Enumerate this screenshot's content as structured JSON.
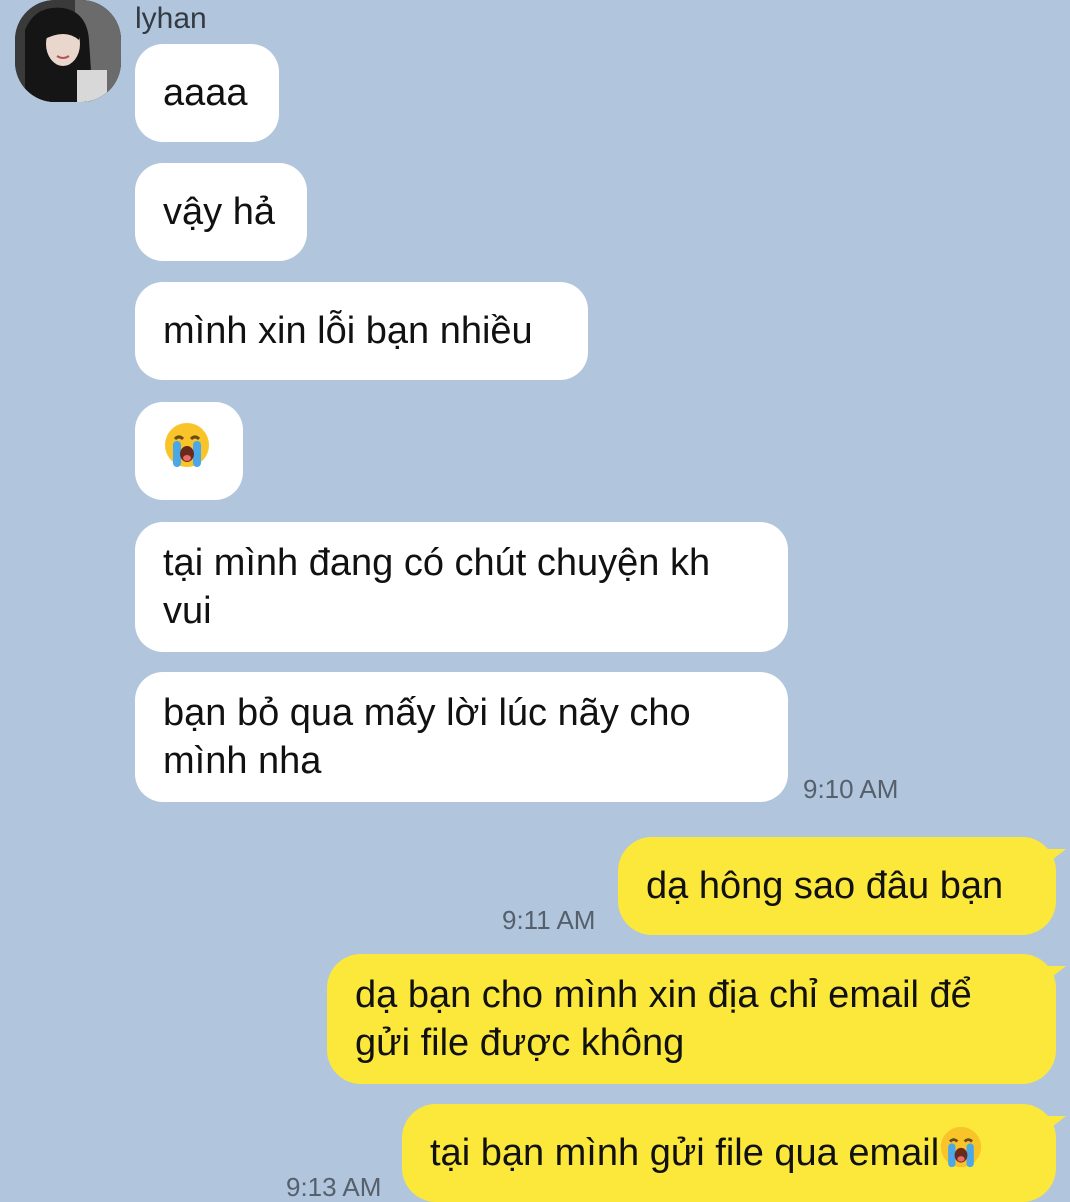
{
  "sender": {
    "name": "lyhan"
  },
  "incoming": [
    {
      "text": "aaaa"
    },
    {
      "text": "vậy hả"
    },
    {
      "text": "mình xin lỗi bạn nhiều"
    },
    {
      "text": "",
      "emoji": "loudly-crying-face-icon"
    },
    {
      "text": "tại mình đang có chút chuyện kh vui"
    },
    {
      "text": "bạn bỏ qua mấy lời lúc nãy cho mình nha",
      "time": "9:10 AM"
    }
  ],
  "outgoing": [
    {
      "text": "dạ hông sao đâu bạn",
      "time": "9:11 AM"
    },
    {
      "text": "dạ bạn cho mình xin địa chỉ email để gửi file được không"
    },
    {
      "text": "tại bạn mình gửi file qua email",
      "emoji": "loudly-crying-face-icon",
      "time": "9:13 AM"
    }
  ],
  "colors": {
    "background": "#b1c6dc",
    "incoming_bubble": "#ffffff",
    "outgoing_bubble": "#fbe83a"
  }
}
